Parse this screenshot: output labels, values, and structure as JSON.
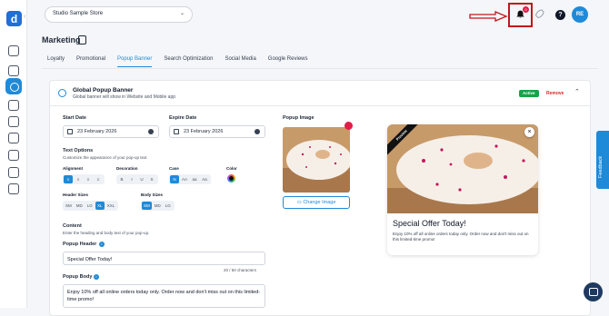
{
  "app": {
    "logo_letter": "d"
  },
  "topbar": {
    "store_name": "Studio Sample Store",
    "notification_count": "0",
    "help_label": "?",
    "avatar_initials": "RE"
  },
  "page": {
    "title": "Marketing"
  },
  "tabs": [
    "Loyalty",
    "Promotional",
    "Popup Banner",
    "Search Optimization",
    "Social Media",
    "Google Reviews"
  ],
  "active_tab": "Popup Banner",
  "card": {
    "title": "Global Popup Banner",
    "subtitle": "Global banner will show in Website and Mobile app",
    "status": "Active",
    "remove_label": "Remove"
  },
  "form": {
    "start_date_label": "Start Date",
    "start_date_value": "23 February 2026",
    "expire_date_label": "Expire Date",
    "expire_date_value": "23 February 2026",
    "text_options_label": "Text Options",
    "text_options_sub": "Customize the appearance of your pop-up text",
    "alignment_label": "Alignment",
    "decoration_label": "Decoration",
    "decoration_options": [
      "B",
      "I",
      "U",
      "S"
    ],
    "case_label": "Case",
    "case_options": [
      "N",
      "AA",
      "aa",
      "Aa"
    ],
    "color_label": "Color",
    "header_sizes_label": "Header Sizes",
    "header_sizes": [
      "SM",
      "MD",
      "LG",
      "XL",
      "XXL"
    ],
    "header_size_selected": "XL",
    "body_sizes_label": "Body Sizes",
    "body_sizes": [
      "SM",
      "MD",
      "LG"
    ],
    "body_size_selected": "SM",
    "content_label": "Content",
    "content_sub": "Enter the heading and body text of your pop-up.",
    "popup_header_label": "Popup Header",
    "popup_header_value": "Special Offer Today!",
    "char_count": "20 / 50 characters",
    "popup_body_label": "Popup Body",
    "popup_body_value": "Enjoy 10% off all online orders today only. Order now and don't miss out on this limited-time promo!",
    "popup_image_label": "Popup Image",
    "change_image_label": "Change Image"
  },
  "preview": {
    "ribbon": "Preview",
    "close": "×",
    "header": "Special Offer Today!",
    "body": "Enjoy 10% off all online orders today only. Order now and don't miss out on this limited-time promo!"
  },
  "feedback_label": "Feedback",
  "colors": {
    "accent": "#1f8ad8",
    "active": "#16a34a",
    "danger": "#dc2626",
    "highlight_box": "#c0171d"
  }
}
